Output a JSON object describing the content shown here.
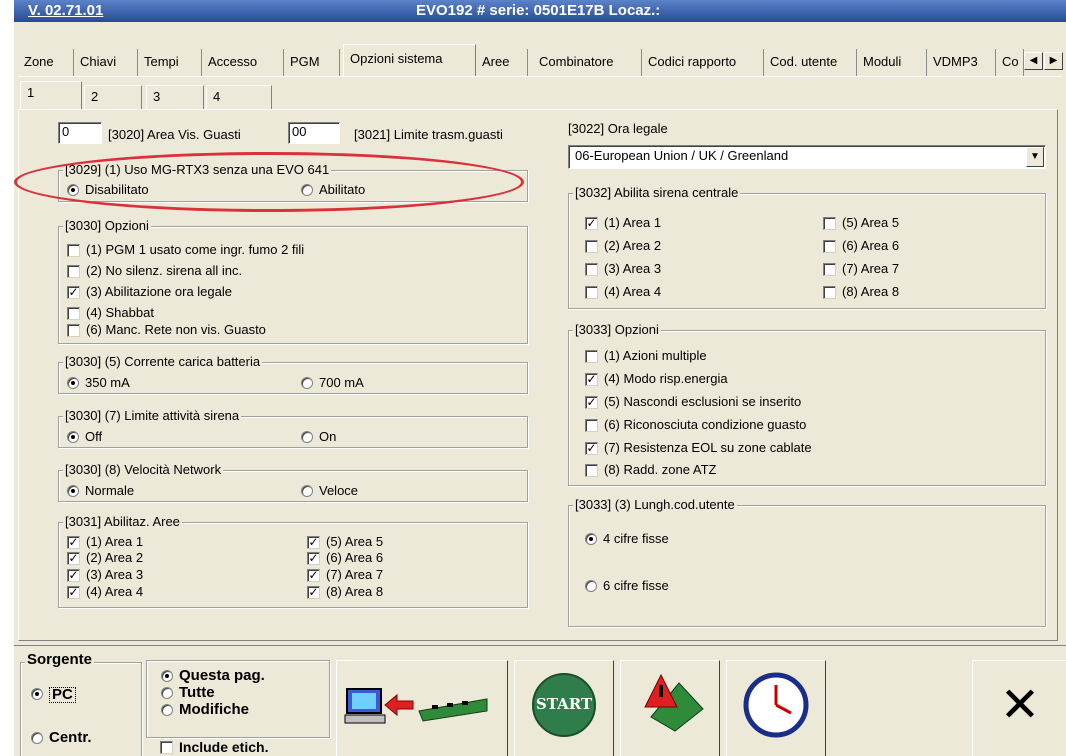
{
  "window": {
    "version": "V. 02.71.01",
    "title": "EVO192  # serie: 0501E17B Locaz.:"
  },
  "main_tabs": [
    "Zone",
    "Chiavi",
    "Tempi",
    "Accesso",
    "PGM",
    "Opzioni sistema",
    "Aree",
    "Combinatore",
    "Codici rapporto",
    "Cod. utente",
    "Moduli",
    "VDMP3",
    "Co"
  ],
  "sub_tabs": [
    "1",
    "2",
    "3",
    "4"
  ],
  "guasti": {
    "area_vis_value": "0",
    "area_vis_label": "[3020] Area Vis. Guasti",
    "limite_value": "00",
    "limite_label": "[3021] Limite trasm.guasti"
  },
  "g3029": {
    "title": "[3029] (1)  Uso MG-RTX3 senza una EVO 641",
    "options": [
      "Disabilitato",
      "Abilitato"
    ]
  },
  "g3030": {
    "title": "[3030]  Opzioni",
    "items": [
      {
        "label": "(1) PGM 1 usato come ingr. fumo 2 fili",
        "checked": false
      },
      {
        "label": "(2) No silenz. sirena all inc.",
        "checked": false
      },
      {
        "label": "(3) Abilitazione ora legale",
        "checked": true
      },
      {
        "label": "(4) Shabbat",
        "checked": false
      },
      {
        "label": "(6) Manc. Rete non vis. Guasto",
        "checked": false
      }
    ]
  },
  "g3030_5": {
    "title": "[3030] (5)  Corrente carica batteria",
    "options": [
      "350 mA",
      "700 mA"
    ]
  },
  "g3030_7": {
    "title": "[3030] (7)  Limite attività sirena",
    "options": [
      "Off",
      "On"
    ]
  },
  "g3030_8": {
    "title": "[3030] (8)  Velocità Network",
    "options": [
      "Normale",
      "Veloce"
    ]
  },
  "g3031": {
    "title": "[3031]  Abilitaz. Aree",
    "items": [
      "(1) Area 1",
      "(2) Area 2",
      "(3) Area 3",
      "(4) Area 4",
      "(5) Area 5",
      "(6) Area 6",
      "(7) Area 7",
      "(8) Area 8"
    ]
  },
  "g3022": {
    "label": "[3022] Ora legale",
    "value": "06-European Union / UK / Greenland"
  },
  "g3032": {
    "title": "[3032]  Abilita sirena centrale",
    "items": [
      "(1) Area 1",
      "(2) Area 2",
      "(3) Area 3",
      "(4) Area 4",
      "(5) Area 5",
      "(6) Area 6",
      "(7) Area 7",
      "(8) Area 8"
    ]
  },
  "g3033": {
    "title": "[3033]  Opzioni",
    "items": [
      {
        "label": "(1) Azioni multiple",
        "checked": false
      },
      {
        "label": "(4) Modo risp.energia",
        "checked": true
      },
      {
        "label": "(5) Nascondi esclusioni se inserito",
        "checked": true
      },
      {
        "label": "(6) Riconosciuta condizione guasto",
        "checked": false
      },
      {
        "label": "(7) Resistenza EOL su zone cablate",
        "checked": true
      },
      {
        "label": "(8) Radd. zone ATZ",
        "checked": false
      }
    ]
  },
  "g3033_3": {
    "title": "[3033]  (3)  Lungh.cod.utente",
    "options": [
      "4 cifre fisse",
      "6 cifre fisse"
    ]
  },
  "bottom": {
    "sorgente": "Sorgente",
    "pc": "PC",
    "centr": "Centr.",
    "pages": [
      "Questa pag.",
      "Tutte",
      "Modifiche"
    ],
    "include": "Include etich.",
    "start": "START",
    "close": "✕"
  },
  "colors": {
    "highlight": "#d9323a",
    "start_green": "#2e7d4a",
    "title_blue": "#2f55a4"
  }
}
